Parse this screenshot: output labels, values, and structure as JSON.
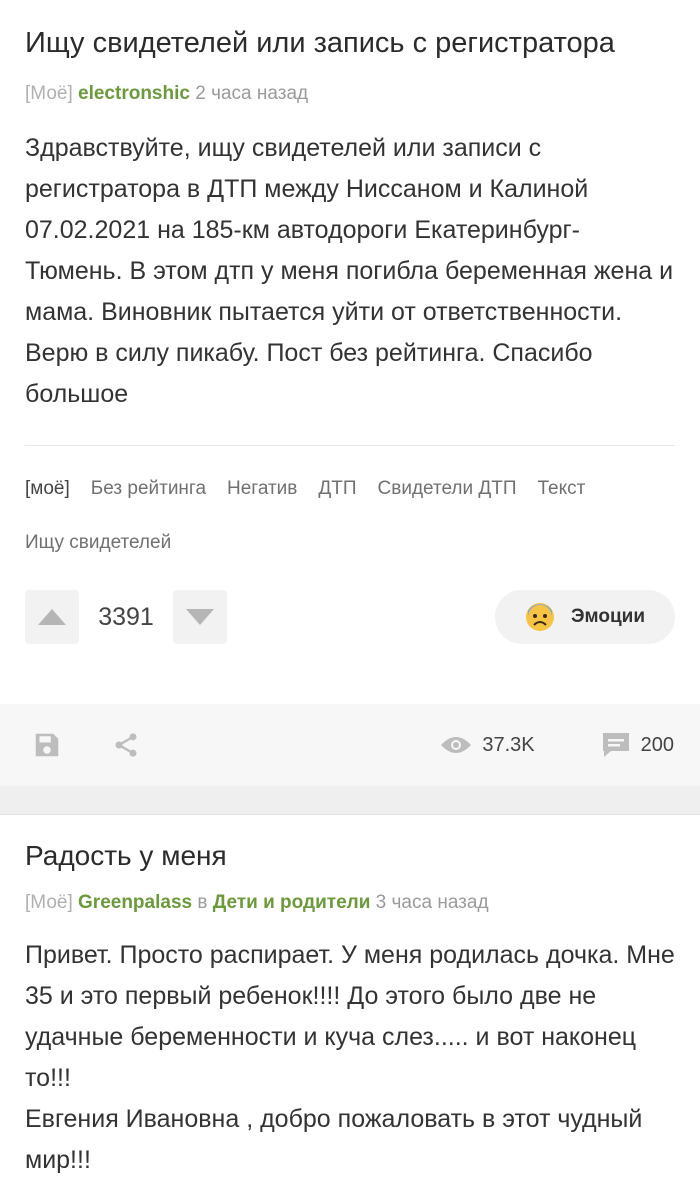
{
  "post1": {
    "title": "Ищу свидетелей или запись с регистратора",
    "meta": {
      "moe": "[Моё]",
      "author": "electronshic",
      "time": "2 часа назад"
    },
    "body": "Здравствуйте, ищу свидетелей или записи с регистратора в ДТП между Ниссаном и Калиной 07.02.2021 на 185-км автодороги Екатеринбург-Тюмень. В этом дтп у меня погибла беременная жена и мама. Виновник пытается уйти от ответственности. Верю в силу пикабу. Пост без рейтинга. Спасибо большое",
    "tags": [
      "[моё]",
      "Без рейтинга",
      "Негатив",
      "ДТП",
      "Свидетели ДТП",
      "Текст",
      "Ищу свидетелей"
    ],
    "rating": "3391",
    "emotions_label": "Эмоции",
    "views": "37.3K",
    "comments": "200"
  },
  "post2": {
    "title": "Радость у меня",
    "meta": {
      "moe": "[Моё]",
      "author": "Greenpalass",
      "in": "в",
      "community": "Дети и родители",
      "time": "3 часа назад"
    },
    "body_lines": [
      "Привет. Просто распирает. У меня родилась дочка. Мне 35 и это первый ребенок!!!! До этого было две не удачные беременности и куча слез..... и вот наконец то!!!",
      "Евгения Ивановна , добро пожаловать в этот чудный мир!!!"
    ]
  },
  "colors": {
    "accent_green": "#6b9a3a",
    "bar_bg": "#f7f7f7"
  },
  "icons": [
    "arrow-up-icon",
    "arrow-down-icon",
    "anxious-face-icon",
    "save-icon",
    "share-icon",
    "eye-icon",
    "comment-icon"
  ]
}
